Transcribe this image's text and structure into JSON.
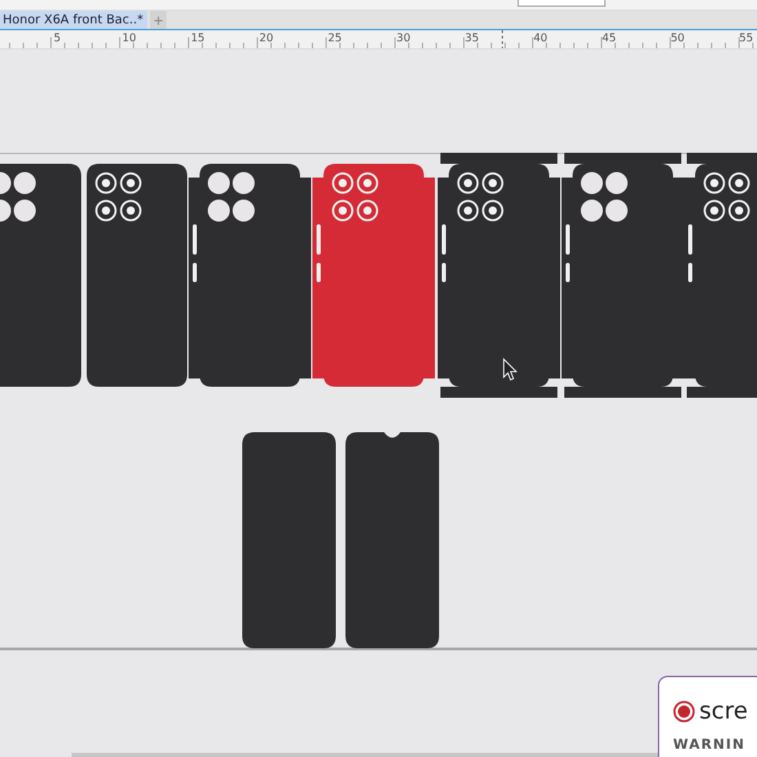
{
  "document_tab": {
    "title": "Honor X6A front Bac..*",
    "selected": true
  },
  "new_tab_button": "+",
  "ruler": [
    "5",
    "10",
    "15",
    "20",
    "25",
    "30",
    "35",
    "40",
    "45",
    "50",
    "55"
  ],
  "templates": [
    {
      "kind": "back-solid",
      "color": "#2e2d30"
    },
    {
      "kind": "back-ring",
      "color": "#2e2d30"
    },
    {
      "kind": "side-solid",
      "color": "#2e2d30"
    },
    {
      "kind": "side-ring",
      "color": "#d52b36"
    },
    {
      "kind": "full-ring",
      "color": "#2e2d30"
    },
    {
      "kind": "full-solid",
      "color": "#2e2d30"
    },
    {
      "kind": "full-ring",
      "color": "#2e2d30"
    },
    {
      "kind": "front",
      "color": "#2e2d30"
    },
    {
      "kind": "front-notch",
      "color": "#2e2d30"
    }
  ],
  "recorder_popup": {
    "brand": "scre",
    "warning": "WARNIN"
  }
}
